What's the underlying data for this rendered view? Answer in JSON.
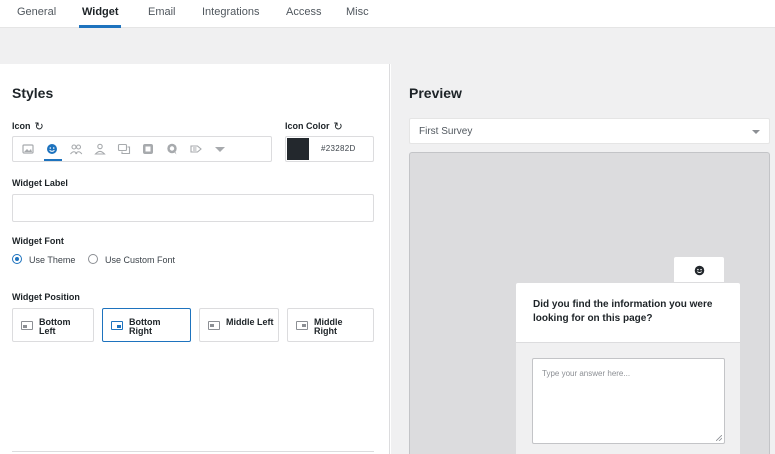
{
  "tabs": [
    {
      "label": "General",
      "active": false
    },
    {
      "label": "Widget",
      "active": true
    },
    {
      "label": "Email",
      "active": false
    },
    {
      "label": "Integrations",
      "active": false
    },
    {
      "label": "Access",
      "active": false
    },
    {
      "label": "Misc",
      "active": false
    }
  ],
  "styles": {
    "title": "Styles",
    "icon_label": "Icon",
    "icon_options": [
      "image-icon",
      "smile-icon",
      "people-icon",
      "user-icon",
      "chat-icon",
      "square-icon",
      "speech-bubble-icon",
      "tag-icon",
      "chevron-down-icon"
    ],
    "selected_icon": "smile-icon",
    "icon_color_label": "Icon Color",
    "icon_color_value": "#23282D",
    "widget_label_label": "Widget Label",
    "widget_label_value": "",
    "widget_font_label": "Widget Font",
    "font_options": {
      "use_theme": "Use Theme",
      "use_custom": "Use Custom Font"
    },
    "font_selected": "Use Theme",
    "widget_position_label": "Widget Position",
    "positions": {
      "bottom_left": "Bottom Left",
      "bottom_right": "Bottom Right",
      "middle_left": "Middle Left",
      "middle_right": "Middle Right"
    },
    "position_selected": "Bottom Right"
  },
  "preview": {
    "title": "Preview",
    "survey_select": "First Survey",
    "question": "Did you find the information you were looking for on this page?",
    "answer_placeholder": "Type your answer here..."
  },
  "colors": {
    "accent": "#1e73be",
    "icon_color": "#23282d"
  }
}
